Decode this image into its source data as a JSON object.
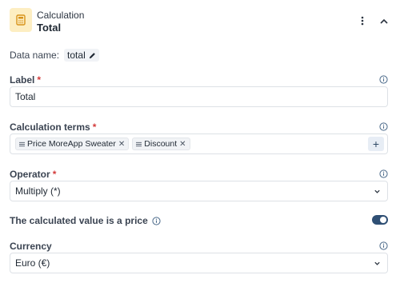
{
  "header": {
    "icon": "calculator-icon",
    "subtitle": "Calculation",
    "title": "Total"
  },
  "data_name": {
    "label": "Data name:",
    "value": "total"
  },
  "label_field": {
    "label": "Label",
    "required_mark": "*",
    "value": "Total"
  },
  "calculation_terms": {
    "label": "Calculation terms",
    "required_mark": "*",
    "terms": [
      {
        "label": "Price MoreApp Sweater"
      },
      {
        "label": "Discount"
      }
    ],
    "add_label": "+"
  },
  "operator": {
    "label": "Operator",
    "required_mark": "*",
    "value": "Multiply (*)"
  },
  "price_toggle": {
    "label": "The calculated value is a price",
    "checked": true
  },
  "currency": {
    "label": "Currency",
    "value": "Euro (€)"
  },
  "colors": {
    "accent": "#2f4f74",
    "badge_bg": "#fdeec2",
    "required": "#d33a3a"
  }
}
